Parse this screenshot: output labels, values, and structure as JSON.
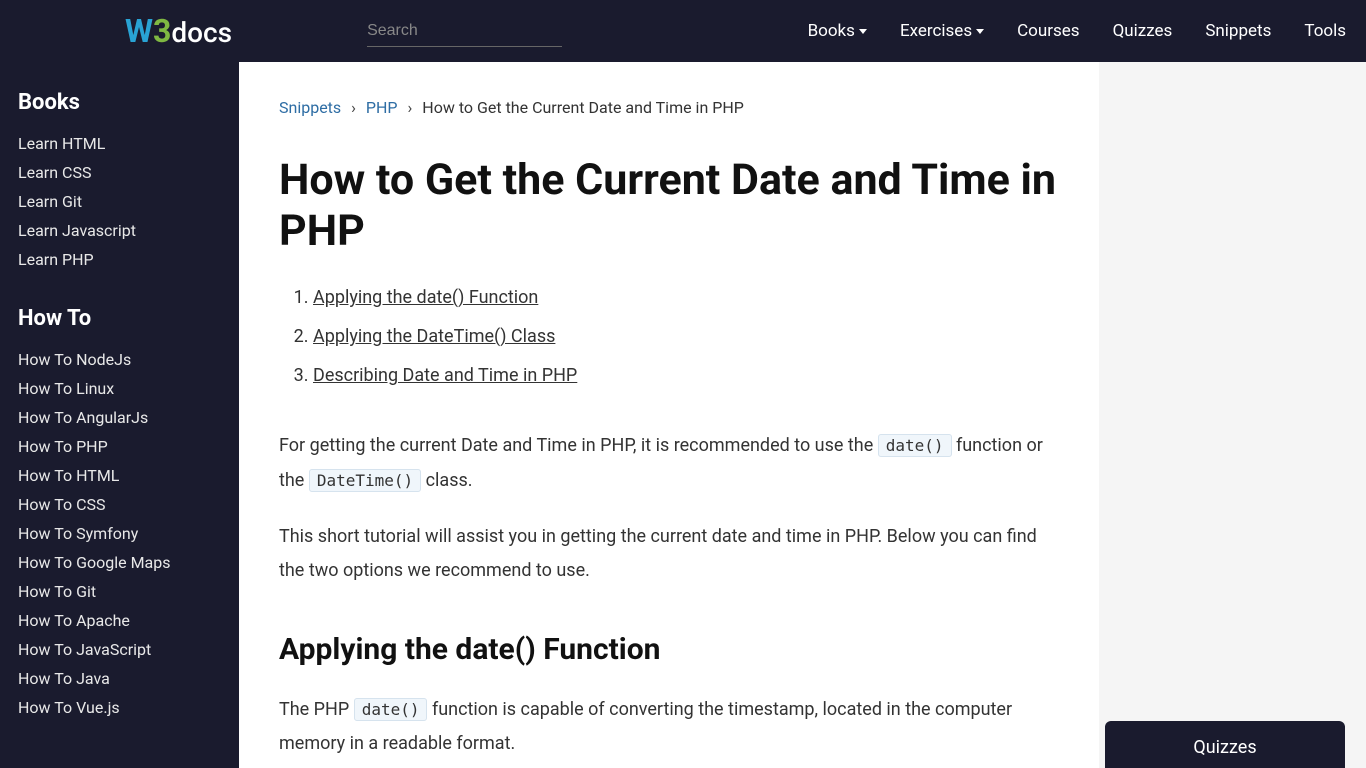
{
  "header": {
    "logo": {
      "w": "W",
      "three": "3",
      "docs": "docs"
    },
    "search_placeholder": "Search",
    "nav": [
      "Books",
      "Exercises",
      "Courses",
      "Quizzes",
      "Snippets",
      "Tools"
    ],
    "nav_caret": [
      true,
      true,
      false,
      false,
      false,
      false
    ]
  },
  "sidebar": {
    "sections": [
      {
        "heading": "Books",
        "items": [
          "Learn HTML",
          "Learn CSS",
          "Learn Git",
          "Learn Javascript",
          "Learn PHP"
        ]
      },
      {
        "heading": "How To",
        "items": [
          "How To NodeJs",
          "How To Linux",
          "How To AngularJs",
          "How To PHP",
          "How To HTML",
          "How To CSS",
          "How To Symfony",
          "How To Google Maps",
          "How To Git",
          "How To Apache",
          "How To JavaScript",
          "How To Java",
          "How To Vue.js"
        ]
      }
    ]
  },
  "breadcrumb": {
    "items": [
      "Snippets",
      "PHP"
    ],
    "sep": "›",
    "current": "How to Get the Current Date and Time in PHP"
  },
  "article": {
    "title": "How to Get the Current Date and Time in PHP",
    "toc": [
      "Applying the date() Function",
      "Applying the DateTime() Class",
      "Describing Date and Time in PHP"
    ],
    "p1_a": "For getting the current Date and Time in PHP, it is recommended to use the ",
    "code1": "date()",
    "p1_b": " function or the ",
    "code2": "DateTime()",
    "p1_c": " class.",
    "p2": "This short tutorial will assist you in getting the current date and time in PHP. Below you can find the two options we recommend to use.",
    "h2_1": "Applying the date() Function",
    "p3_a": "The PHP ",
    "code3": "date()",
    "p3_b": " function is capable of converting the timestamp, located in the computer memory in a readable format."
  },
  "right": {
    "quiz_label": "Quizzes"
  }
}
